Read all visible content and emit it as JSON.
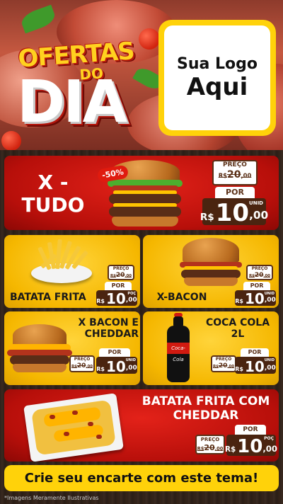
{
  "header": {
    "title_top": "OFERTAS",
    "title_mid": "DO",
    "title_main": "DIA",
    "logo_line1": "Sua Logo",
    "logo_line2": "Aqui"
  },
  "labels": {
    "preco": "PREÇO",
    "por": "POR",
    "currency": "R$",
    "unit": "UNID",
    "unit_portion": "POÇ"
  },
  "products": [
    {
      "name_line1": "X -",
      "name_line2": "TUDO",
      "discount_badge": "-50%",
      "old_price": "20",
      "old_cents": ",00",
      "new_price": "10",
      "new_cents": ",00",
      "unit": "UNID",
      "card_color": "red"
    },
    {
      "name_line1": "BATATA FRITA",
      "old_price": "20",
      "old_cents": ",00",
      "new_price": "10",
      "new_cents": ",00",
      "unit": "POÇ",
      "card_color": "yellow"
    },
    {
      "name_line1": "X-BACON",
      "old_price": "20",
      "old_cents": ",00",
      "new_price": "10",
      "new_cents": ",00",
      "unit": "UNID",
      "card_color": "yellow"
    },
    {
      "name_line1": "X BACON E",
      "name_line2": "CHEDDAR",
      "old_price": "20",
      "old_cents": ",00",
      "new_price": "10",
      "new_cents": ",00",
      "unit": "UNID",
      "card_color": "yellow"
    },
    {
      "name_line1": "COCA COLA",
      "name_line2": "2L",
      "bottle_label": "Coca-Cola",
      "old_price": "20",
      "old_cents": ",00",
      "new_price": "10",
      "new_cents": ",00",
      "unit": "UNID",
      "card_color": "yellow"
    },
    {
      "name_line1": "BATATA FRITA COM",
      "name_line2": "CHEDDAR",
      "old_price": "20",
      "old_cents": ",00",
      "new_price": "10",
      "new_cents": ",00",
      "unit": "POÇ",
      "card_color": "red"
    }
  ],
  "cta": "Crie seu encarte com este tema!",
  "disclaimer": "*Imagens Meramente Ilustrativas",
  "colors": {
    "red": "#c8140d",
    "yellow": "#ffd20a",
    "brown": "#4a2410"
  }
}
